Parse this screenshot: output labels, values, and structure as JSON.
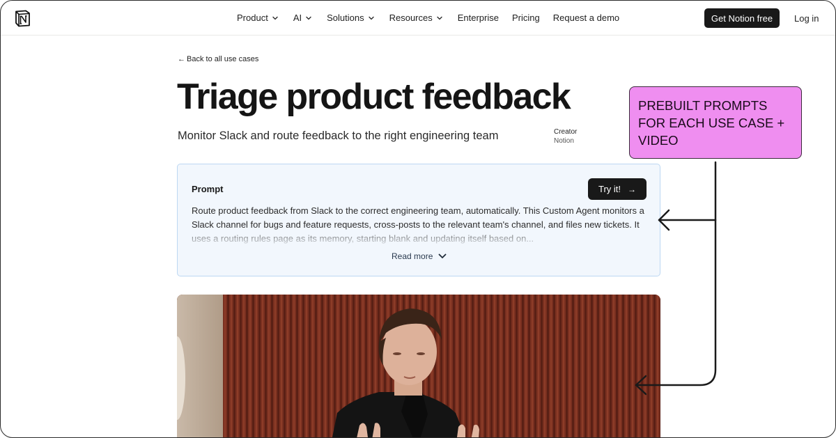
{
  "nav": {
    "items": [
      {
        "label": "Product",
        "dropdown": true
      },
      {
        "label": "AI",
        "dropdown": true
      },
      {
        "label": "Solutions",
        "dropdown": true
      },
      {
        "label": "Resources",
        "dropdown": true
      },
      {
        "label": "Enterprise",
        "dropdown": false
      },
      {
        "label": "Pricing",
        "dropdown": false
      },
      {
        "label": "Request a demo",
        "dropdown": false
      }
    ],
    "cta_label": "Get Notion free",
    "login_label": "Log in"
  },
  "page": {
    "back_label": "Back to all use cases",
    "title": "Triage product feedback",
    "subtitle": "Monitor Slack and route feedback to the right engineering team",
    "creator_label": "Creator",
    "creator_value": "Notion"
  },
  "prompt_card": {
    "title": "Prompt",
    "try_label": "Try it!",
    "body": "Route product feedback from Slack to the correct engineering team, automatically. This Custom Agent monitors a Slack channel for bugs and feature requests, cross-posts to the relevant team's channel, and files new tickets. It uses a routing rules page as its memory, starting blank and updating itself based on...",
    "read_more_label": "Read more"
  },
  "annotation": {
    "text": "PREBUILT PROMPTS FOR EACH USE CASE + VIDEO",
    "color": "#ef8ef0"
  },
  "icons": {
    "logo": "notion-logo-icon",
    "chevron": "chevron-down-icon",
    "back": "arrow-left-icon",
    "try": "arrow-right-icon"
  }
}
